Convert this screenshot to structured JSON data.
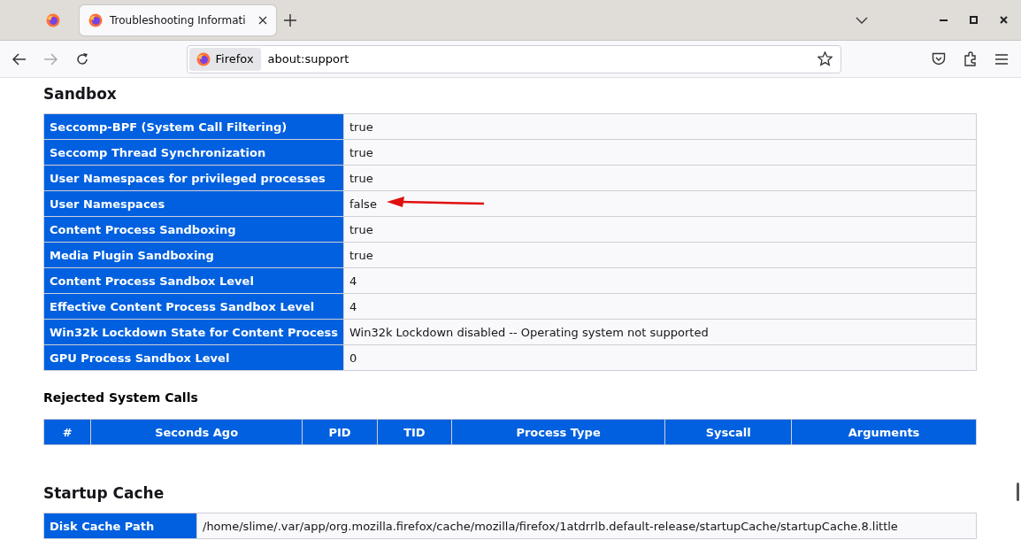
{
  "tabs": [
    {
      "kind": "pinned",
      "selected": false
    },
    {
      "kind": "page",
      "title": "Troubleshooting Informati",
      "selected": true
    }
  ],
  "urlbar": {
    "identity": "Firefox",
    "url": "about:support"
  },
  "sections": [
    {
      "kind": "heading",
      "text": "Sandbox"
    },
    {
      "kind": "kv",
      "rows": [
        {
          "key": "Seccomp-BPF (System Call Filtering)",
          "value": "true",
          "annotated": false
        },
        {
          "key": "Seccomp Thread Synchronization",
          "value": "true",
          "annotated": false
        },
        {
          "key": "User Namespaces for privileged processes",
          "value": "true",
          "annotated": false
        },
        {
          "key": "User Namespaces",
          "value": "false",
          "annotated": true
        },
        {
          "key": "Content Process Sandboxing",
          "value": "true",
          "annotated": false
        },
        {
          "key": "Media Plugin Sandboxing",
          "value": "true",
          "annotated": false
        },
        {
          "key": "Content Process Sandbox Level",
          "value": "4",
          "annotated": false
        },
        {
          "key": "Effective Content Process Sandbox Level",
          "value": "4",
          "annotated": false
        },
        {
          "key": "Win32k Lockdown State for Content Process",
          "value": "Win32k Lockdown disabled -- Operating system not supported",
          "annotated": false
        },
        {
          "key": "GPU Process Sandbox Level",
          "value": "0",
          "annotated": false
        }
      ]
    },
    {
      "kind": "subheading",
      "text": "Rejected System Calls"
    },
    {
      "kind": "columns",
      "columns": [
        "#",
        "Seconds Ago",
        "PID",
        "TID",
        "Process Type",
        "Syscall",
        "Arguments"
      ]
    },
    {
      "kind": "heading",
      "text": "Startup Cache"
    },
    {
      "kind": "kv",
      "narrow": true,
      "rows": [
        {
          "key": "Disk Cache Path",
          "value": "/home/slime/.var/app/org.mozilla.firefox/cache/mozilla/firefox/1atdrrlb.default-release/startupCache/startupCache.8.little",
          "annotated": false
        }
      ]
    }
  ]
}
